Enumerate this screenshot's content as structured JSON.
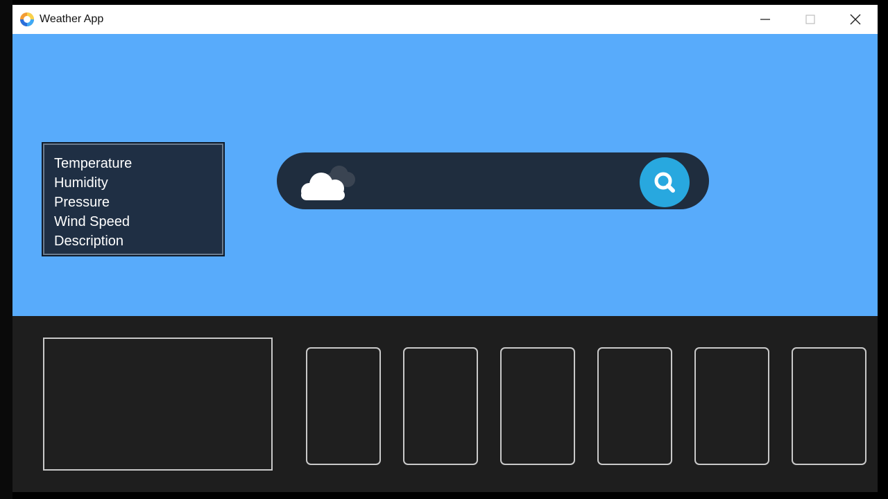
{
  "window": {
    "title": "Weather App",
    "controls": [
      "minimize",
      "maximize",
      "close"
    ]
  },
  "info_panel": {
    "labels": [
      "Temperature",
      "Humidity",
      "Pressure",
      "Wind Speed",
      "Description"
    ]
  },
  "search": {
    "value": "",
    "placeholder": "",
    "weather_icon": "cloud-icon",
    "button_icon": "search-icon"
  },
  "forecast": {
    "current_card": "",
    "day_cards": [
      "",
      "",
      "",
      "",
      "",
      ""
    ]
  },
  "colors": {
    "top_background": "#58abfb",
    "info_box": "#1f2f44",
    "search_bar": "#1f2d3e",
    "search_button": "#28a8df",
    "bottom_background": "#1e1e1e",
    "card_border": "#c9c9c9"
  }
}
